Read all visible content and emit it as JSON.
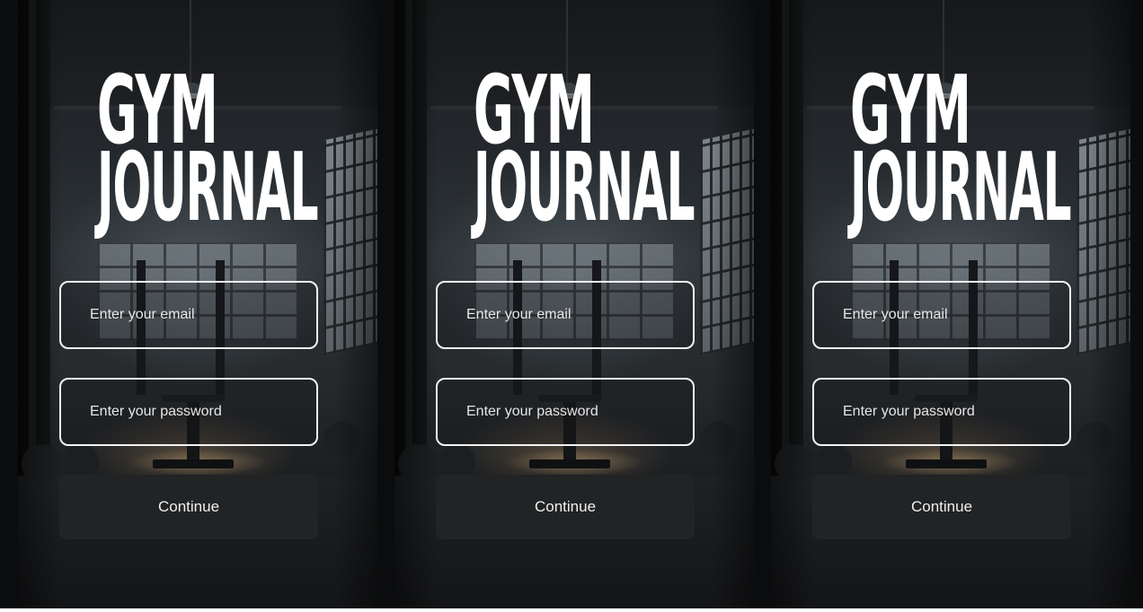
{
  "screens": [
    {
      "logo": {
        "line1": "GYM",
        "line2": "JOURNAL"
      },
      "email": {
        "placeholder": "Enter your email"
      },
      "password": {
        "placeholder": "Enter your password"
      },
      "continue_label": "Continue"
    },
    {
      "logo": {
        "line1": "GYM",
        "line2": "JOURNAL"
      },
      "email": {
        "placeholder": "Enter your email"
      },
      "password": {
        "placeholder": "Enter your password"
      },
      "continue_label": "Continue"
    },
    {
      "logo": {
        "line1": "GYM",
        "line2": "JOURNAL"
      },
      "email": {
        "placeholder": "Enter your email"
      },
      "password": {
        "placeholder": "Enter your password"
      },
      "continue_label": "Continue"
    }
  ],
  "colors": {
    "field_border": "#f2f2f2",
    "button_bg": "#222325",
    "text": "#ffffff"
  }
}
